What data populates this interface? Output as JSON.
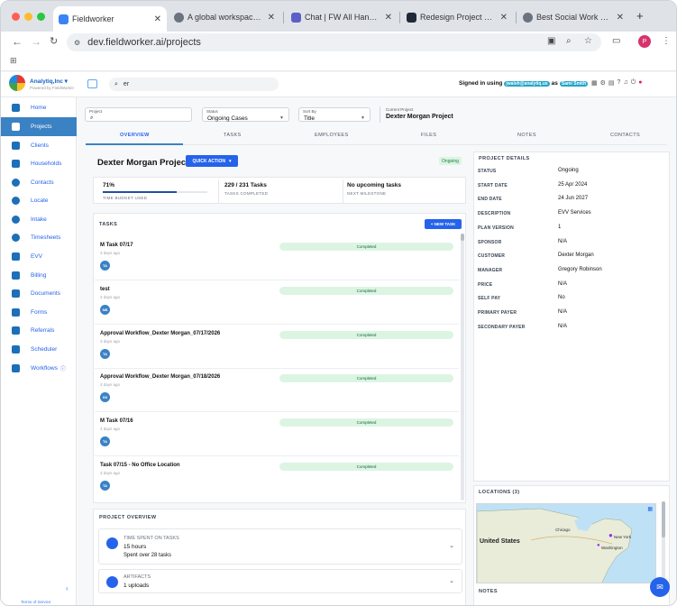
{
  "browser": {
    "tabs": [
      {
        "title": "Fieldworker",
        "active": true,
        "icon": "fieldworker-favicon"
      },
      {
        "title": "A global workspace in la",
        "active": false,
        "icon": "globe-favicon"
      },
      {
        "title": "Chat | FW All Hands | Mi",
        "active": false,
        "icon": "teams-favicon"
      },
      {
        "title": "Redesign Project screen",
        "active": false,
        "icon": "trello-favicon"
      },
      {
        "title": "Best Social Work Care M",
        "active": false,
        "icon": "globe-favicon"
      }
    ],
    "new_tab": "+",
    "url": "dev.fieldworker.ai/projects",
    "profile_initial": "P"
  },
  "header": {
    "org_name": "Analytiq,Inc ▾",
    "org_sub": "Powered by FieldWorker",
    "search_value": "er",
    "signed_in_prefix": "Signed in using",
    "signed_in_email": "jwalsh@analytiq.us",
    "as_text": "as",
    "user_name": "Sami Smith"
  },
  "sidebar": {
    "items": [
      {
        "label": "Home",
        "icon": "home-icon"
      },
      {
        "label": "Projects",
        "icon": "projects-icon",
        "active": true
      },
      {
        "label": "Clients",
        "icon": "clients-icon"
      },
      {
        "label": "Households",
        "icon": "households-icon"
      },
      {
        "label": "Contacts",
        "icon": "contacts-icon"
      },
      {
        "label": "Locate",
        "icon": "location-pin-icon"
      },
      {
        "label": "Intake",
        "icon": "plus-circle-icon"
      },
      {
        "label": "Timesheets",
        "icon": "clock-icon"
      },
      {
        "label": "EVV",
        "icon": "map-icon"
      },
      {
        "label": "Billing",
        "icon": "billing-icon"
      },
      {
        "label": "Documents",
        "icon": "document-icon"
      },
      {
        "label": "Forms",
        "icon": "forms-icon"
      },
      {
        "label": "Referrals",
        "icon": "referrals-icon"
      },
      {
        "label": "Scheduler",
        "icon": "calendar-icon"
      },
      {
        "label": "Workflows",
        "icon": "workflow-icon"
      }
    ],
    "terms": "Terms of Service"
  },
  "filters": {
    "project_label": "Project",
    "project_value": "",
    "status_label": "Status",
    "status_value": "Ongoing Cases",
    "sort_label": "Sort By",
    "sort_value": "Title",
    "current_project_label": "Current Project",
    "current_project": "Dexter Morgan Project"
  },
  "tabs": [
    "OVERVIEW",
    "TASKS",
    "EMPLOYEES",
    "FILES",
    "NOTES",
    "CONTACTS"
  ],
  "project": {
    "title": "Dexter Morgan Project",
    "quick_action": "QUICK ACTION",
    "status": "Ongoing",
    "time_budget_value": "71%",
    "time_budget_fraction": 0.71,
    "time_budget_label": "TIME BUDGET USED",
    "tasks_value": "229 / 231 Tasks",
    "tasks_label": "TASKS COMPLETED",
    "milestone_value": "No upcoming tasks",
    "milestone_label": "NEXT MILESTONE"
  },
  "tasks_section": {
    "title": "TASKS",
    "new_task": "+  NEW TASK",
    "items": [
      {
        "name": "M Task 07/17",
        "date": "3 days ago",
        "assignee": "TA",
        "status": "Completed"
      },
      {
        "name": "test",
        "date": "3 days ago",
        "assignee": "NB",
        "status": "Completed"
      },
      {
        "name": "Approval Workflow_Dexter Morgan_07/17/2026",
        "date": "3 days ago",
        "assignee": "TA",
        "status": "Completed"
      },
      {
        "name": "Approval Workflow_Dexter Morgan_07/18/2026",
        "date": "3 days ago",
        "assignee": "SS",
        "status": "Completed"
      },
      {
        "name": "M Task 07/16",
        "date": "4 days ago",
        "assignee": "TA",
        "status": "Completed"
      },
      {
        "name": "Task 07/15 - No Office Location",
        "date": "3 days ago",
        "assignee": "TA",
        "status": "Completed"
      }
    ]
  },
  "overview": {
    "title": "PROJECT OVERVIEW",
    "time_label": "TIME SPENT ON TASKS",
    "time_value": "15 hours",
    "time_sub": "Spent over 28 tasks",
    "artifacts_label": "ARTIFACTS",
    "artifacts_value": "1 uploads"
  },
  "details": {
    "title": "PROJECT DETAILS",
    "rows": [
      {
        "key": "STATUS",
        "value": "Ongoing"
      },
      {
        "key": "START DATE",
        "value": "25 Apr 2024"
      },
      {
        "key": "END DATE",
        "value": "24 Jun 2027"
      },
      {
        "key": "DESCRIPTION",
        "value": "EVV Services"
      },
      {
        "key": "PLAN VERSION",
        "value": "1"
      },
      {
        "key": "SPONSOR",
        "value": "N/A"
      },
      {
        "key": "CUSTOMER",
        "value": "Dexter Morgan"
      },
      {
        "key": "MANAGER",
        "value": "Gregory Robinson"
      },
      {
        "key": "PRICE",
        "value": "N/A"
      },
      {
        "key": "SELF PAY",
        "value": "No"
      },
      {
        "key": "PRIMARY PAYER",
        "value": "N/A"
      },
      {
        "key": "SECONDARY PAYER",
        "value": "N/A"
      }
    ]
  },
  "locations": {
    "title": "LOCATIONS (3)",
    "map_labels": [
      "United States",
      "Chicago",
      "New York",
      "Washington"
    ]
  },
  "notes": {
    "title": "NOTES"
  }
}
